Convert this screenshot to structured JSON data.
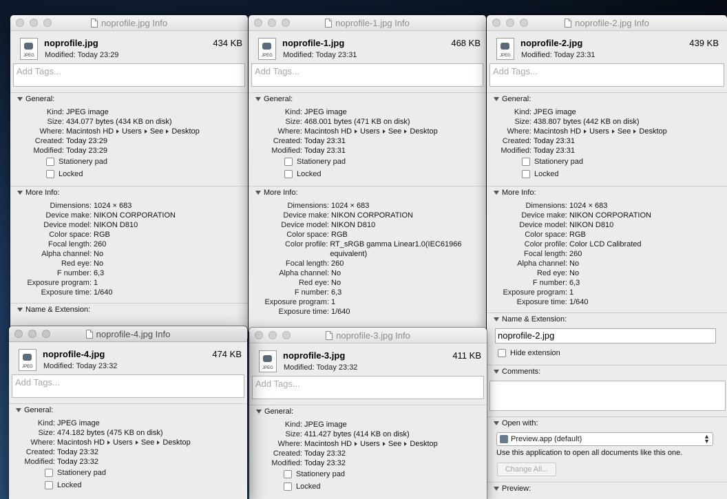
{
  "labels": {
    "add_tags": "Add Tags...",
    "general": "General:",
    "more_info": "More Info:",
    "name_extension": "Name & Extension:",
    "comments": "Comments:",
    "open_with": "Open with:",
    "preview": "Preview:",
    "kind": "Kind:",
    "size": "Size:",
    "where": "Where:",
    "created": "Created:",
    "modified": "Modified:",
    "stationery": "Stationery pad",
    "locked": "Locked",
    "dimensions": "Dimensions:",
    "device_make": "Device make:",
    "device_model": "Device model:",
    "color_space": "Color space:",
    "color_profile": "Color profile:",
    "focal_length": "Focal length:",
    "alpha_channel": "Alpha channel:",
    "red_eye": "Red eye:",
    "f_number": "F number:",
    "exposure_program": "Exposure program:",
    "exposure_time": "Exposure time:",
    "hide_extension": "Hide extension"
  },
  "where_path": [
    "Macintosh HD",
    "Users",
    "See",
    "Desktop"
  ],
  "windows": {
    "w0": {
      "title": "noprofile.jpg Info",
      "name": "noprofile.jpg",
      "modified_line": "Modified: Today 23:29",
      "size_short": "434 KB",
      "kind": "JPEG image",
      "size": "434.077 bytes (434 KB on disk)",
      "created": "Today 23:29",
      "modified": "Today 23:29",
      "dimensions": "1024 × 683",
      "device_make": "NIKON CORPORATION",
      "device_model": "NIKON D810",
      "color_space": "RGB",
      "focal_length": "260",
      "alpha_channel": "No",
      "red_eye": "No",
      "f_number": "6,3",
      "exposure_program": "1",
      "exposure_time": "1/640"
    },
    "w1": {
      "title": "noprofile-1.jpg Info",
      "name": "noprofile-1.jpg",
      "modified_line": "Modified: Today 23:31",
      "size_short": "468 KB",
      "kind": "JPEG image",
      "size": "468.001 bytes (471 KB on disk)",
      "created": "Today 23:31",
      "modified": "Today 23:31",
      "dimensions": "1024 × 683",
      "device_make": "NIKON CORPORATION",
      "device_model": "NIKON D810",
      "color_space": "RGB",
      "color_profile": "RT_sRGB gamma Linear1.0(IEC61966 equivalent)",
      "focal_length": "260",
      "alpha_channel": "No",
      "red_eye": "No",
      "f_number": "6,3",
      "exposure_program": "1",
      "exposure_time": "1/640"
    },
    "w2": {
      "title": "noprofile-2.jpg Info",
      "name": "noprofile-2.jpg",
      "modified_line": "Modified: Today 23:31",
      "size_short": "439 KB",
      "kind": "JPEG image",
      "size": "438.807 bytes (442 KB on disk)",
      "created": "Today 23:31",
      "modified": "Today 23:31",
      "dimensions": "1024 × 683",
      "device_make": "NIKON CORPORATION",
      "device_model": "NIKON D810",
      "color_space": "RGB",
      "color_profile": "Color LCD Calibrated",
      "focal_length": "260",
      "alpha_channel": "No",
      "red_eye": "No",
      "f_number": "6,3",
      "exposure_program": "1",
      "exposure_time": "1/640",
      "name_field": "noprofile-2.jpg",
      "open_with_app": "Preview.app (default)",
      "open_with_desc": "Use this application to open all documents like this one.",
      "change_all": "Change All..."
    },
    "w3": {
      "title": "noprofile-3.jpg Info",
      "name": "noprofile-3.jpg",
      "modified_line": "Modified: Today 23:32",
      "size_short": "411 KB",
      "kind": "JPEG image",
      "size": "411.427 bytes (414 KB on disk)",
      "created": "Today 23:32",
      "modified": "Today 23:32"
    },
    "w4": {
      "title": "noprofile-4.jpg Info",
      "name": "noprofile-4.jpg",
      "modified_line": "Modified: Today 23:32",
      "size_short": "474 KB",
      "kind": "JPEG image",
      "size": "474.182 bytes (475 KB on disk)",
      "created": "Today 23:32",
      "modified": "Today 23:32"
    }
  }
}
